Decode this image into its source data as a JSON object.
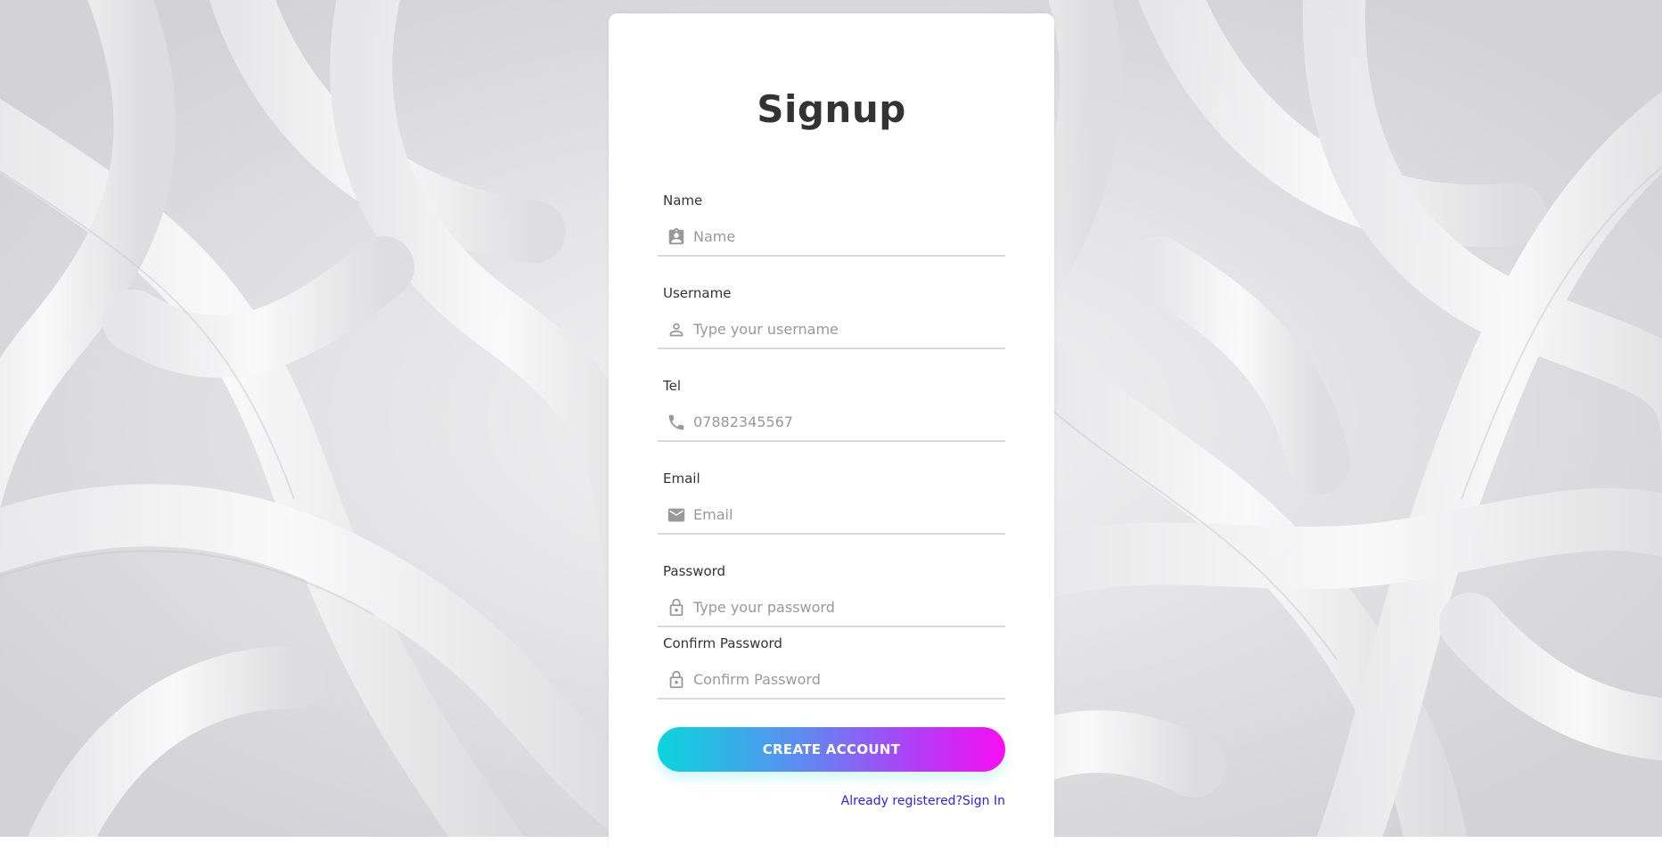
{
  "form": {
    "title": "Signup",
    "fields": [
      {
        "label": "Name",
        "placeholder": "Name",
        "value": "",
        "icon": "contact-card-icon"
      },
      {
        "label": "Username",
        "placeholder": "Type your username",
        "value": "",
        "icon": "person-icon"
      },
      {
        "label": "Tel",
        "placeholder": "07882345567",
        "value": "",
        "icon": "phone-icon"
      },
      {
        "label": "Email",
        "placeholder": "Email",
        "value": "",
        "icon": "envelope-icon"
      },
      {
        "label": "Password",
        "placeholder": "Type your password",
        "value": "",
        "icon": "lock-icon"
      },
      {
        "label": "Confirm Password",
        "placeholder": "Confirm Password",
        "value": "",
        "icon": "lock-icon"
      }
    ],
    "submit_label": "CREATE ACCOUNT",
    "already_registered_text": "Already registered?",
    "sign_in_link": "Sign In"
  },
  "colors": {
    "gradient_start": "#0ad5dc",
    "gradient_end": "#f80ef3",
    "link": "#2d1ff5",
    "title": "#333333",
    "icon": "#999999"
  }
}
